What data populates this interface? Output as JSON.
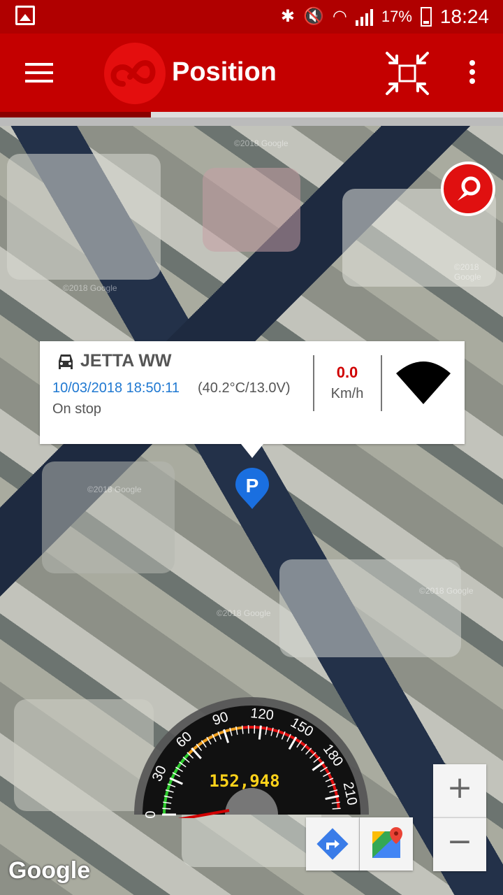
{
  "status_bar": {
    "battery_percent": "17%",
    "time": "18:24",
    "icons": [
      "gallery-icon",
      "bluetooth-icon",
      "mute-icon",
      "wifi-icon",
      "signal-icon",
      "battery-icon"
    ]
  },
  "toolbar": {
    "title": "Position",
    "icons": [
      "menu-icon",
      "app-logo-icon",
      "fullscreen-icon",
      "more-vert-icon"
    ],
    "accent": "#c40000",
    "progress_fraction": 0.3
  },
  "popup": {
    "vehicle_name": "JETTA WW",
    "datetime": "10/03/2018 18:50:11",
    "telemetry": "(40.2°C/13.0V)",
    "status": "On stop",
    "speed_value": "0.0",
    "speed_unit": "Km/h",
    "icons": [
      "car-icon",
      "signal-strength-icon"
    ]
  },
  "map": {
    "watermarks": [
      "©2018 Google",
      "©2018 Google",
      "©2018 Google",
      "©2018 Google",
      "©2018 Google",
      "©2018 Google"
    ],
    "marker_label": "P",
    "attribution": "Google"
  },
  "gauge": {
    "ticks": [
      "0",
      "30",
      "60",
      "90",
      "120",
      "150",
      "180",
      "210"
    ],
    "odometer": "152,948",
    "speed": 0
  },
  "controls": {
    "zoom_in": "+",
    "zoom_out": "−",
    "icons": [
      "directions-icon",
      "google-maps-icon",
      "locate-icon"
    ]
  }
}
